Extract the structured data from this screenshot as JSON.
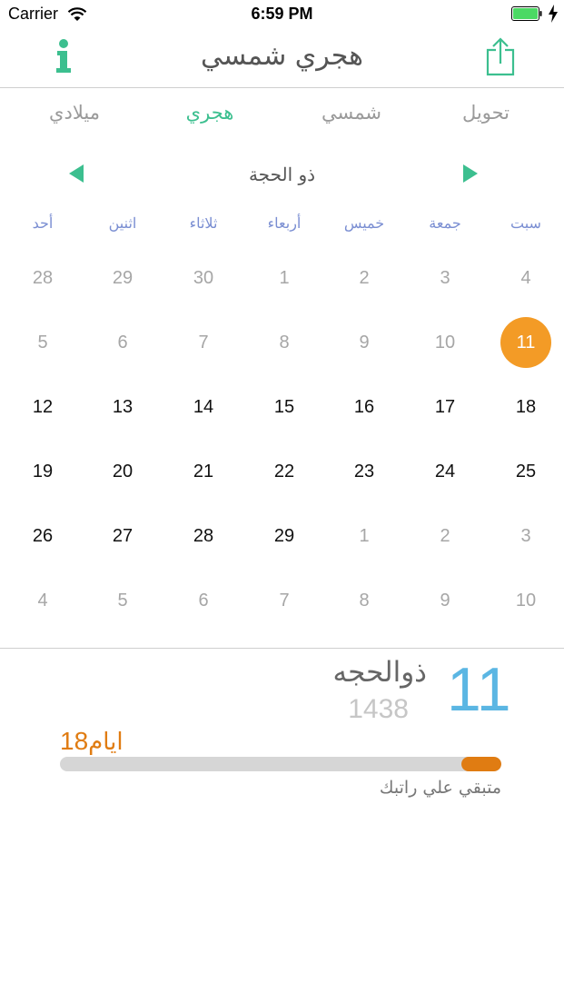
{
  "status_bar": {
    "carrier": "Carrier",
    "time": "6:59 PM",
    "wifi_icon": "wifi-icon",
    "battery_icon": "battery-charging-icon"
  },
  "nav": {
    "title": "هجري شمسي",
    "left_icon": "info-icon",
    "right_icon": "share-icon",
    "accent_color": "#3cbf8f"
  },
  "tabs": [
    {
      "label": "ميلادي",
      "active": false
    },
    {
      "label": "هجري",
      "active": true
    },
    {
      "label": "شمسي",
      "active": false
    },
    {
      "label": "تحويل",
      "active": false
    }
  ],
  "calendar": {
    "month_title": "ذو الحجة",
    "prev_icon": "triangle-left-icon",
    "next_icon": "triangle-right-icon",
    "weekdays": [
      "أحد",
      "اثنين",
      "ثلاثاء",
      "أربعاء",
      "خميس",
      "جمعة",
      "سبت"
    ],
    "today": 11,
    "today_color": "#f39b26",
    "rows": [
      [
        {
          "d": 28,
          "cur": false
        },
        {
          "d": 29,
          "cur": false
        },
        {
          "d": 30,
          "cur": false
        },
        {
          "d": 1,
          "cur": false
        },
        {
          "d": 2,
          "cur": false
        },
        {
          "d": 3,
          "cur": false
        },
        {
          "d": 4,
          "cur": false
        }
      ],
      [
        {
          "d": 5,
          "cur": false
        },
        {
          "d": 6,
          "cur": false
        },
        {
          "d": 7,
          "cur": false
        },
        {
          "d": 8,
          "cur": false
        },
        {
          "d": 9,
          "cur": false
        },
        {
          "d": 10,
          "cur": false
        },
        {
          "d": 11,
          "cur": true,
          "today": true
        }
      ],
      [
        {
          "d": 12,
          "cur": true
        },
        {
          "d": 13,
          "cur": true
        },
        {
          "d": 14,
          "cur": true
        },
        {
          "d": 15,
          "cur": true
        },
        {
          "d": 16,
          "cur": true
        },
        {
          "d": 17,
          "cur": true
        },
        {
          "d": 18,
          "cur": true
        }
      ],
      [
        {
          "d": 19,
          "cur": true
        },
        {
          "d": 20,
          "cur": true
        },
        {
          "d": 21,
          "cur": true
        },
        {
          "d": 22,
          "cur": true
        },
        {
          "d": 23,
          "cur": true
        },
        {
          "d": 24,
          "cur": true
        },
        {
          "d": 25,
          "cur": true
        }
      ],
      [
        {
          "d": 26,
          "cur": true
        },
        {
          "d": 27,
          "cur": true
        },
        {
          "d": 28,
          "cur": true
        },
        {
          "d": 29,
          "cur": true
        },
        {
          "d": 1,
          "cur": false
        },
        {
          "d": 2,
          "cur": false
        },
        {
          "d": 3,
          "cur": false
        }
      ],
      [
        {
          "d": 4,
          "cur": false
        },
        {
          "d": 5,
          "cur": false
        },
        {
          "d": 6,
          "cur": false
        },
        {
          "d": 7,
          "cur": false
        },
        {
          "d": 8,
          "cur": false
        },
        {
          "d": 9,
          "cur": false
        },
        {
          "d": 10,
          "cur": false
        }
      ]
    ]
  },
  "info": {
    "day": "11",
    "month_name": "ذوالحجه",
    "year": "1438",
    "remaining_number": "18",
    "remaining_unit": "ايام",
    "progress_fraction": 0.09,
    "caption": "متبقي علي راتبك",
    "progress_color": "#e07c12",
    "day_color": "#5bb6e3"
  }
}
